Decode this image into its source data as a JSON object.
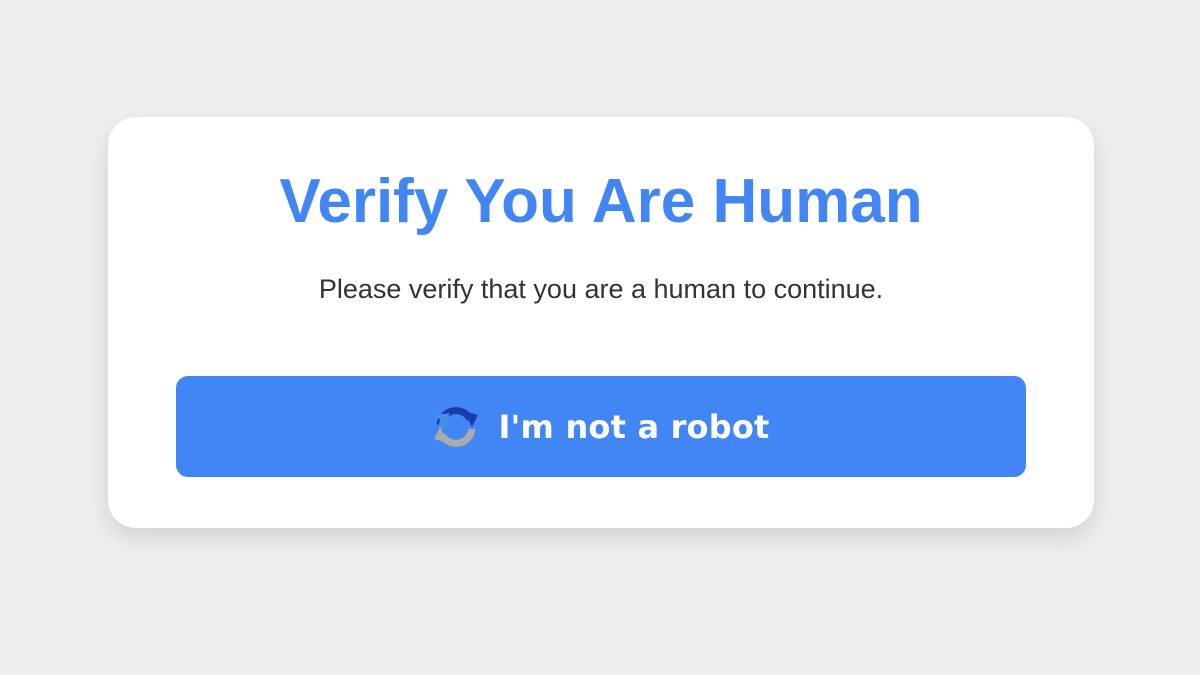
{
  "page": {
    "background_color": "#efefef"
  },
  "card": {
    "title": "Verify You Are Human",
    "subtitle": "Please verify that you are a human to continue.",
    "title_color": "#4285f4",
    "subtitle_color": "#333333"
  },
  "button": {
    "label": "I'm not a robot",
    "icon": "recaptcha-icon",
    "background_color": "#4285f4",
    "text_color": "#ffffff"
  }
}
